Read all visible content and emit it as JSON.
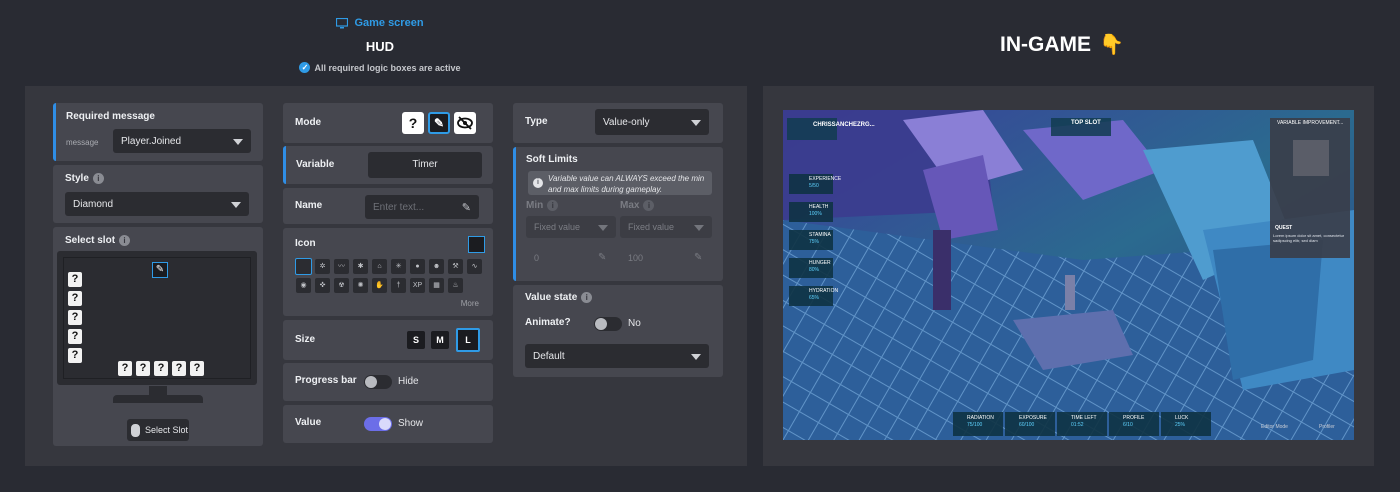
{
  "header": {
    "game_screen_label": "Game screen",
    "hud_title": "HUD",
    "status_text": "All required logic boxes are active",
    "ingame_title": "IN-GAME",
    "ingame_emoji": "👇"
  },
  "left_col": {
    "required_message": {
      "label": "Required message",
      "field_label": "message",
      "value": "Player.Joined"
    },
    "style": {
      "label": "Style",
      "value": "Diamond"
    },
    "select_slot": {
      "label": "Select slot",
      "button": "Select Slot",
      "slot_glyph": "?"
    }
  },
  "mid_col": {
    "mode": {
      "label": "Mode",
      "options": [
        "?",
        "edit",
        "hide"
      ],
      "selected": "edit"
    },
    "variable": {
      "label": "Variable",
      "value": "Timer"
    },
    "name": {
      "label": "Name",
      "placeholder": "Enter text..."
    },
    "icon": {
      "label": "Icon",
      "more": "More"
    },
    "size": {
      "label": "Size",
      "options": [
        "S",
        "M",
        "L"
      ],
      "selected": "L"
    },
    "progress_bar": {
      "label": "Progress bar",
      "state_label": "Hide",
      "on": false
    },
    "value": {
      "label": "Value",
      "state_label": "Show",
      "on": true
    }
  },
  "right_col": {
    "type": {
      "label": "Type",
      "value": "Value-only"
    },
    "soft_limits": {
      "label": "Soft Limits",
      "note": "Variable value can ALWAYS exceed the min and max limits during gameplay.",
      "min_label": "Min",
      "max_label": "Max",
      "min_mode": "Fixed value",
      "max_mode": "Fixed value",
      "min_value": "0",
      "max_value": "100"
    },
    "value_state": {
      "label": "Value state",
      "animate_label": "Animate?",
      "animate_state": "No",
      "animate_on": false,
      "preset": "Default"
    }
  },
  "game_hud": {
    "player_name": "CHRISSANCHEZRG...",
    "top_slot": "TOP SLOT",
    "quest_label": "QUEST",
    "quest_text": "Lorem ipsum dolor sit amet, consectetur sadipscing elitr, sed diam",
    "variable_title": "VARIABLE IMPROVEMENT...",
    "stats": [
      {
        "name": "EXPERIENCE",
        "value": "5/50"
      },
      {
        "name": "HEALTH",
        "value": "100%"
      },
      {
        "name": "STAMINA",
        "value": "75%"
      },
      {
        "name": "HUNGER",
        "value": "80%"
      },
      {
        "name": "HYDRATION",
        "value": "65%"
      }
    ],
    "bottom_stats": [
      {
        "name": "RADIATION",
        "value": "75/100"
      },
      {
        "name": "EXPOSURE",
        "value": "60/100"
      },
      {
        "name": "TIME LEFT",
        "value": "01:52"
      },
      {
        "name": "PROFILE",
        "value": "6/10"
      },
      {
        "name": "LUCK",
        "value": "25%"
      }
    ],
    "editor_mode": "Editor Mode",
    "profiler": "Profiler"
  },
  "colors": {
    "accent": "#2f9be6",
    "panel": "#46474f",
    "toggle_on": "#6c6ee8"
  }
}
